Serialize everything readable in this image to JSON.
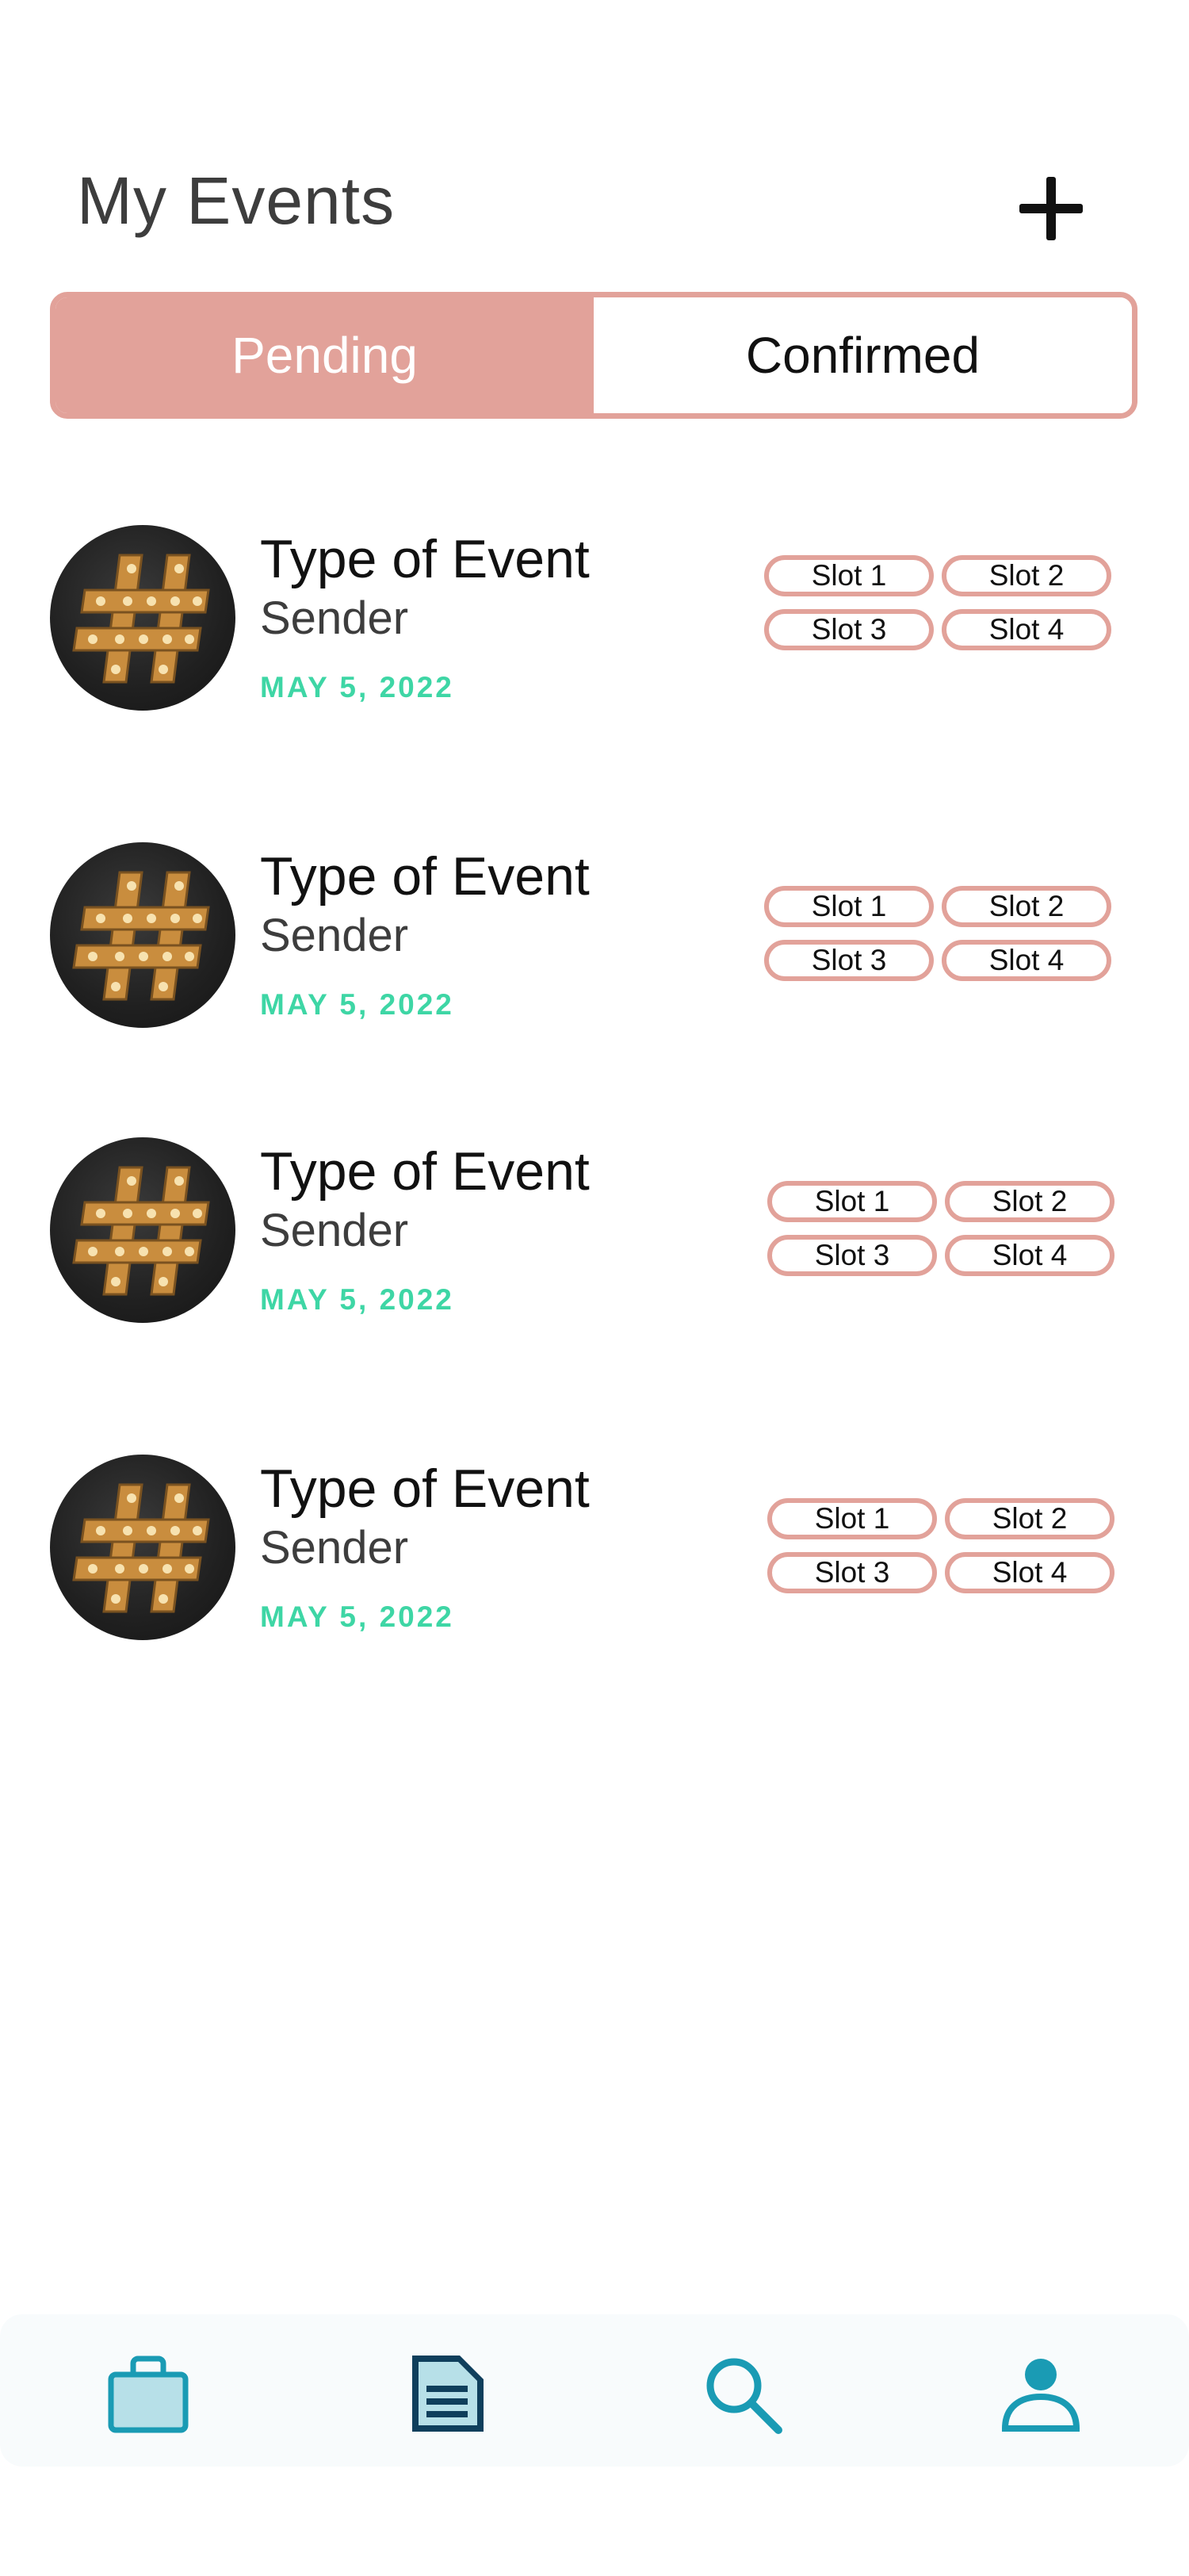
{
  "header": {
    "title": "My Events",
    "add_icon": "plus-icon"
  },
  "tabs": [
    {
      "label": "Pending",
      "active": true
    },
    {
      "label": "Confirmed",
      "active": false
    }
  ],
  "events": [
    {
      "type": "Type of Event",
      "sender": "Sender",
      "date": "MAY 5, 2022",
      "icon": "hashtag-icon",
      "slots": [
        "Slot 1",
        "Slot 2",
        "Slot 3",
        "Slot 4"
      ]
    },
    {
      "type": "Type of Event",
      "sender": "Sender",
      "date": "MAY 5, 2022",
      "icon": "hashtag-icon",
      "slots": [
        "Slot 1",
        "Slot 2",
        "Slot 3",
        "Slot 4"
      ]
    },
    {
      "type": "Type of Event",
      "sender": "Sender",
      "date": "MAY 5, 2022",
      "icon": "hashtag-icon",
      "slots": [
        "Slot 1",
        "Slot 2",
        "Slot 3",
        "Slot 4"
      ]
    },
    {
      "type": "Type of Event",
      "sender": "Sender",
      "date": "MAY 5, 2022",
      "icon": "hashtag-icon",
      "slots": [
        "Slot 1",
        "Slot 2",
        "Slot 3",
        "Slot 4"
      ]
    }
  ],
  "bottom_nav": [
    {
      "icon": "briefcase-icon"
    },
    {
      "icon": "document-icon"
    },
    {
      "icon": "search-icon"
    },
    {
      "icon": "profile-icon"
    }
  ],
  "colors": {
    "accent": "#e2a29a",
    "date": "#3ed6a5",
    "nav": "#1a9bb4",
    "nav_dark": "#0f3f5c"
  }
}
